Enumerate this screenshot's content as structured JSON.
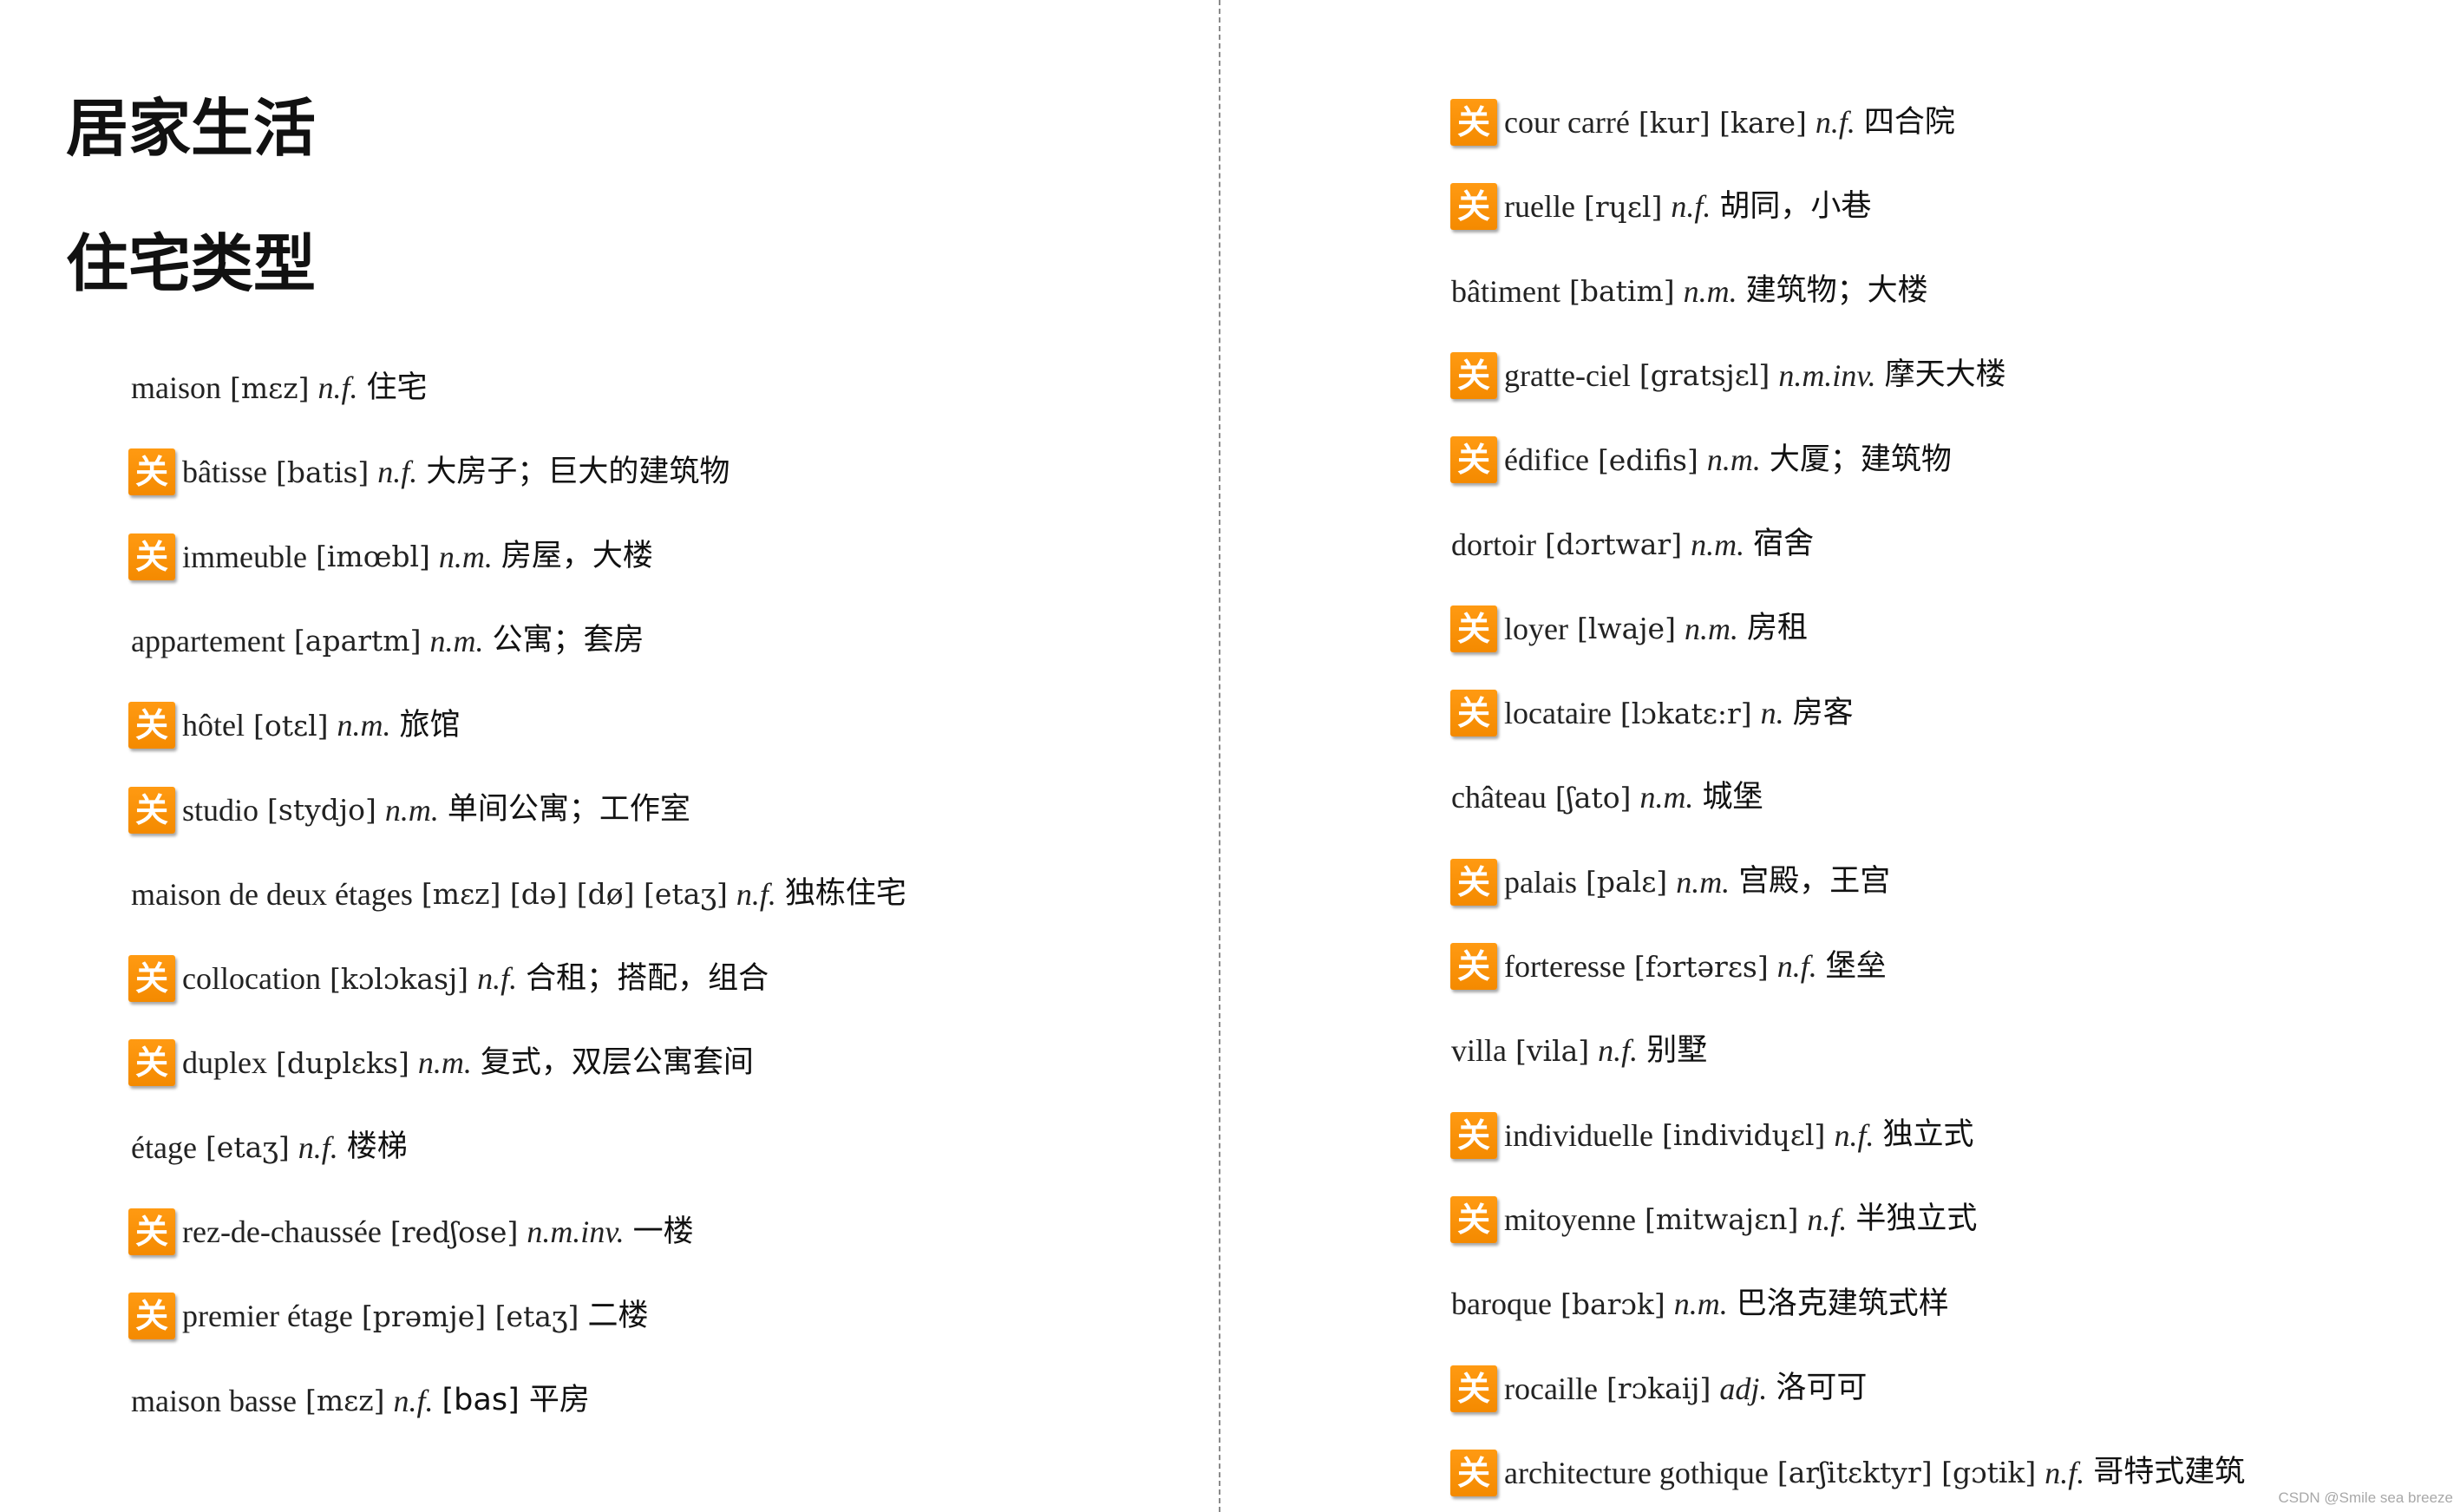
{
  "headings": {
    "title": "居家生活",
    "subtitle": "住宅类型"
  },
  "badge_char": "关",
  "colors": {
    "badge": "#f48a00",
    "badge_text": "#ffffff",
    "divider": "#8a8a8a"
  },
  "left_entries": [
    {
      "badge": false,
      "word": "maison",
      "ipa": "[mɛz]",
      "pos": "n.f.",
      "zh": "住宅"
    },
    {
      "badge": true,
      "word": "bâtisse",
      "ipa": "[batis]",
      "pos": "n.f.",
      "zh": "大房子；巨大的建筑物"
    },
    {
      "badge": true,
      "word": "immeuble",
      "ipa": "[imœbl]",
      "pos": "n.m.",
      "zh": "房屋，大楼"
    },
    {
      "badge": false,
      "word": "appartement",
      "ipa": "[apartm]",
      "pos": "n.m.",
      "zh": "公寓；套房"
    },
    {
      "badge": true,
      "word": "hôtel",
      "ipa": "[otɛl]",
      "pos": "n.m.",
      "zh": "旅馆"
    },
    {
      "badge": true,
      "word": "studio",
      "ipa": "[stydjo]",
      "pos": "n.m.",
      "zh": "单间公寓；工作室"
    },
    {
      "badge": false,
      "word": "maison de deux étages",
      "ipa": "[mɛz] [də] [dø] [etaʒ]",
      "pos": "n.f.",
      "zh": "独栋住宅"
    },
    {
      "badge": true,
      "word": "collocation",
      "ipa": "[kɔlɔkasj]",
      "pos": "n.f.",
      "zh": "合租；搭配，组合"
    },
    {
      "badge": true,
      "word": "duplex",
      "ipa": "[duplɛks]",
      "pos": "n.m.",
      "zh": "复式，双层公寓套间"
    },
    {
      "badge": false,
      "word": "étage",
      "ipa": "[etaʒ]",
      "pos": "n.f.",
      "zh": "楼梯"
    },
    {
      "badge": true,
      "word": "rez-de-chaussée",
      "ipa": "[redʃose]",
      "pos": "n.m.inv.",
      "zh": "一楼"
    },
    {
      "badge": true,
      "word": "premier étage",
      "ipa": "[prəmje] [etaʒ]",
      "pos": "",
      "zh": "二楼"
    },
    {
      "badge": false,
      "word": "maison basse",
      "ipa": "[mɛz]",
      "pos": "n.f.",
      "zh": "[bas] 平房"
    }
  ],
  "right_entries": [
    {
      "badge": true,
      "word": "cour carré",
      "ipa": "[kur] [kare]",
      "pos": "n.f.",
      "zh": "四合院"
    },
    {
      "badge": true,
      "word": "ruelle",
      "ipa": "[rɥɛl]",
      "pos": "n.f.",
      "zh": "胡同，小巷"
    },
    {
      "badge": false,
      "word": "bâtiment",
      "ipa": "[batim]",
      "pos": "n.m.",
      "zh": "建筑物；大楼"
    },
    {
      "badge": true,
      "word": "gratte-ciel",
      "ipa": "[gratsjɛl]",
      "pos": "n.m.inv.",
      "zh": "摩天大楼"
    },
    {
      "badge": true,
      "word": "édifice",
      "ipa": "[edifis]",
      "pos": "n.m.",
      "zh": "大厦；建筑物"
    },
    {
      "badge": false,
      "word": "dortoir",
      "ipa": "[dɔrtwar]",
      "pos": "n.m.",
      "zh": "宿舍"
    },
    {
      "badge": true,
      "word": "loyer",
      "ipa": "[lwaje]",
      "pos": "n.m.",
      "zh": "房租"
    },
    {
      "badge": true,
      "word": "locataire",
      "ipa": "[lɔkatɛ:r]",
      "pos": "n.",
      "zh": "房客"
    },
    {
      "badge": false,
      "word": "château",
      "ipa": "[ʃato]",
      "pos": "n.m.",
      "zh": "城堡"
    },
    {
      "badge": true,
      "word": "palais",
      "ipa": "[palɛ]",
      "pos": "n.m.",
      "zh": "宫殿，王宫"
    },
    {
      "badge": true,
      "word": "forteresse",
      "ipa": "[fɔrtərɛs]",
      "pos": "n.f.",
      "zh": "堡垒"
    },
    {
      "badge": false,
      "word": "villa",
      "ipa": "[vila]",
      "pos": "n.f.",
      "zh": "别墅"
    },
    {
      "badge": true,
      "word": "individuelle",
      "ipa": "[individɥɛl]",
      "pos": "n.f.",
      "zh": "独立式"
    },
    {
      "badge": true,
      "word": "mitoyenne",
      "ipa": "[mitwajɛn]",
      "pos": "n.f.",
      "zh": "半独立式"
    },
    {
      "badge": false,
      "word": "baroque",
      "ipa": "[barɔk]",
      "pos": "n.m.",
      "zh": "巴洛克建筑式样"
    },
    {
      "badge": true,
      "word": "rocaille",
      "ipa": "[rɔkaij]",
      "pos": "adj.",
      "zh": "洛可可"
    },
    {
      "badge": true,
      "word": "architecture gothique",
      "ipa": "[arʃitɛktyr] [gɔtik]",
      "pos": "n.f.",
      "zh": "哥特式建筑"
    }
  ],
  "watermark": "CSDN @Smile sea breeze"
}
